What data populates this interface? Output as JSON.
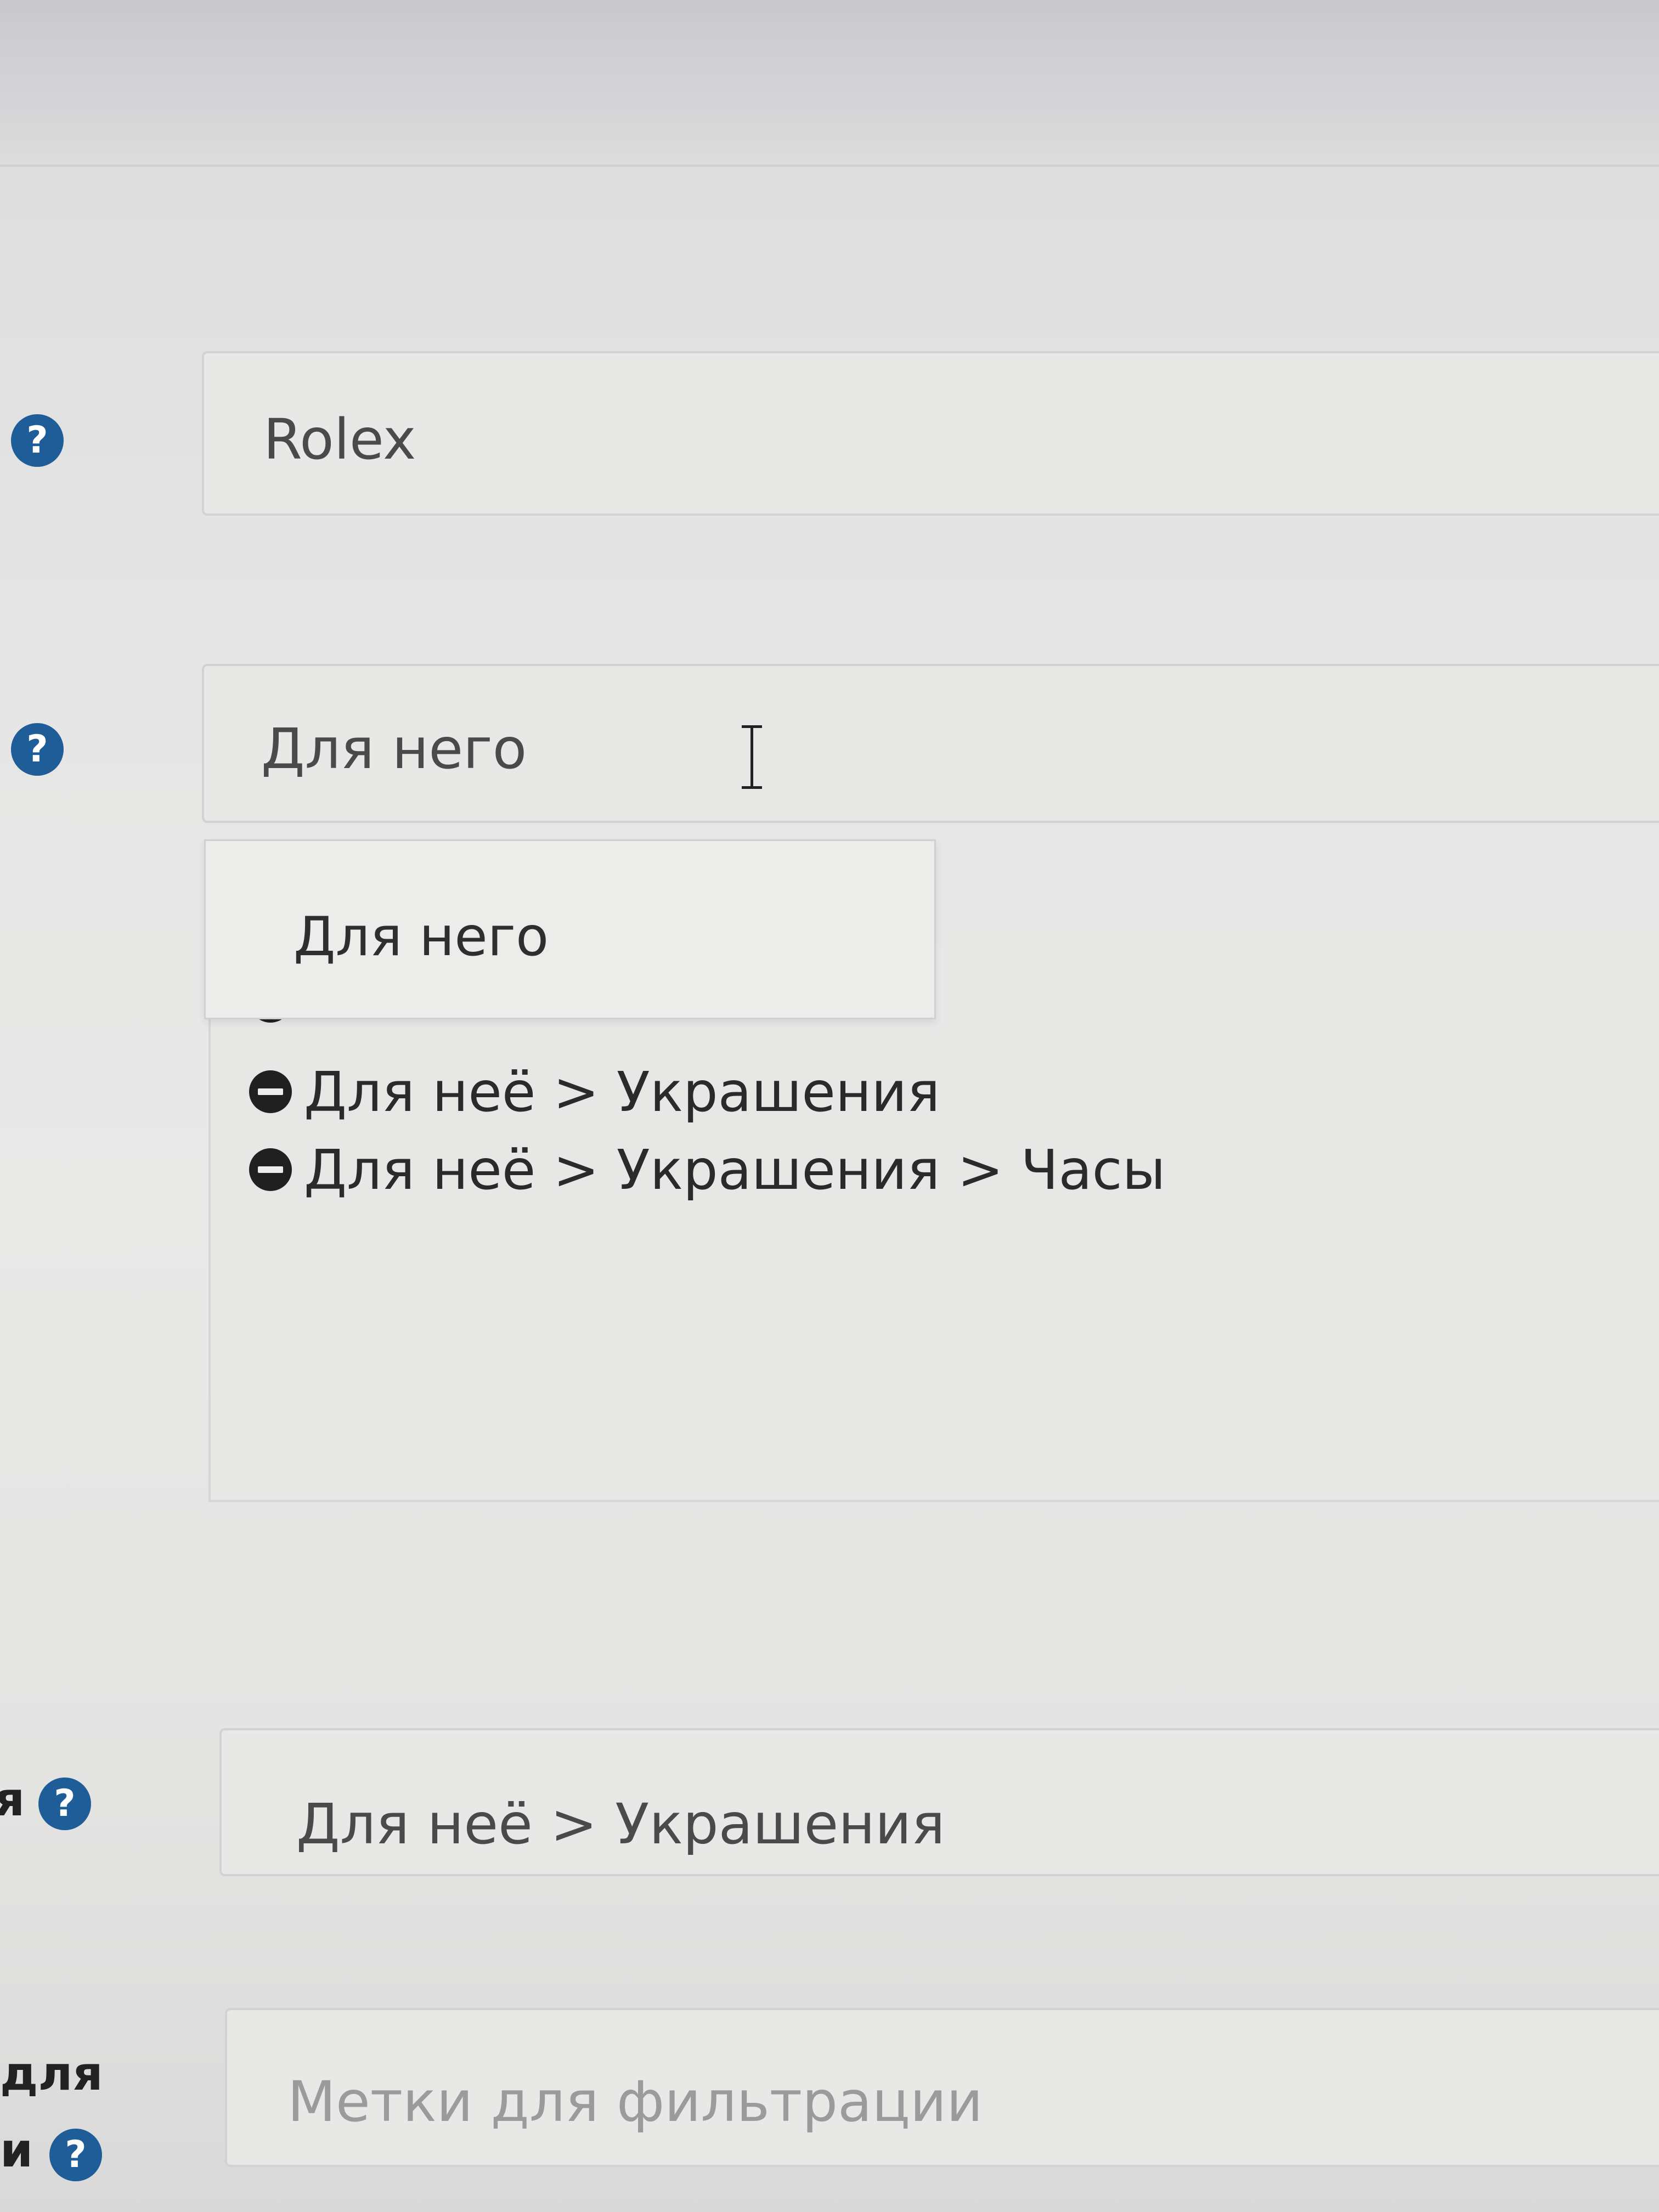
{
  "form": {
    "manufacturer": {
      "value": "Rolex"
    },
    "categories": {
      "input_value": "Для него",
      "suggestion": "Для него",
      "selected": [
        "Для неё > Украшения",
        "Для неё  >  Украшения > Часы"
      ]
    },
    "main_category": {
      "value": "Для неё  >  Украшения"
    },
    "filters": {
      "label_line1": "для",
      "label_line2": "и",
      "placeholder": "Метки для фильтрации"
    },
    "truncated_label": "я",
    "help_icon_glyph": "?"
  },
  "colors": {
    "help_icon": "#1f5d99",
    "remove_icon": "#202020"
  }
}
